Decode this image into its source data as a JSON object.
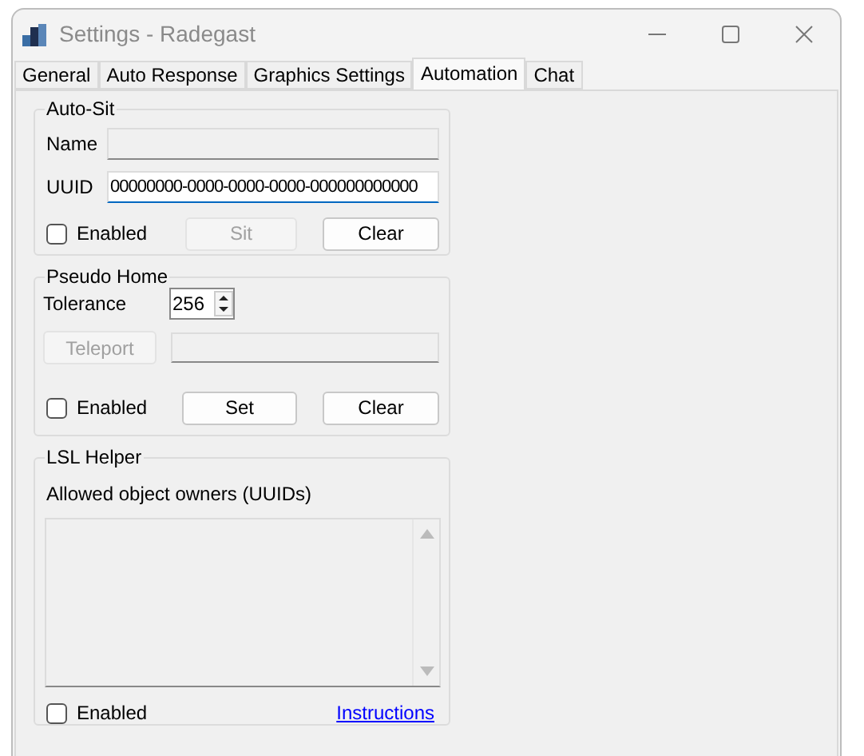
{
  "window": {
    "title": "Settings - Radegast"
  },
  "tabs": [
    {
      "label": "General",
      "selected": false
    },
    {
      "label": "Auto Response",
      "selected": false
    },
    {
      "label": "Graphics Settings",
      "selected": false
    },
    {
      "label": "Automation",
      "selected": true
    },
    {
      "label": "Chat",
      "selected": false
    }
  ],
  "auto_sit": {
    "title": "Auto-Sit",
    "name_label": "Name",
    "uuid_label": "UUID",
    "uuid_value": "00000000-0000-0000-0000-000000000000",
    "enabled": {
      "label": "Enabled",
      "checked": false
    },
    "sit_button": {
      "label": "Sit",
      "disabled": true
    },
    "clear_button": {
      "label": "Clear",
      "disabled": false
    }
  },
  "pseudo_home": {
    "title": "Pseudo Home",
    "tolerance_label": "Tolerance",
    "tolerance_value": "256",
    "teleport_button": {
      "label": "Teleport",
      "disabled": true
    },
    "enabled": {
      "label": "Enabled",
      "checked": false
    },
    "set_button": {
      "label": "Set",
      "disabled": false
    },
    "clear_button": {
      "label": "Clear",
      "disabled": false
    }
  },
  "lsl_helper": {
    "title": "LSL Helper",
    "owners_label": "Allowed object owners (UUIDs)",
    "enabled": {
      "label": "Enabled",
      "checked": false
    },
    "instructions_link": "Instructions"
  }
}
